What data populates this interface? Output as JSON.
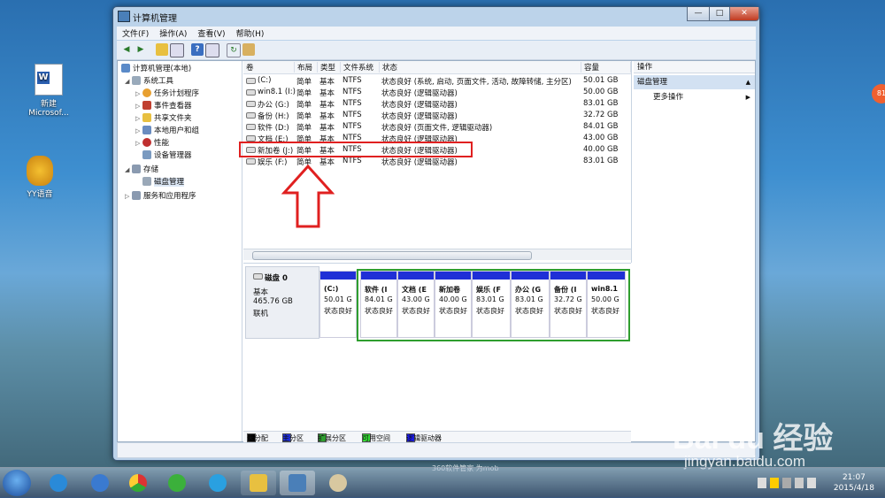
{
  "desktop": {
    "icons": [
      {
        "label": "新建\nMicrosof..."
      },
      {
        "label": "YY语音"
      }
    ],
    "badge": "81"
  },
  "window": {
    "title": "计算机管理",
    "btn_min": "—",
    "btn_max": "□",
    "btn_close": "✕"
  },
  "menu": [
    "文件(F)",
    "操作(A)",
    "查看(V)",
    "帮助(H)"
  ],
  "tree": [
    {
      "label": "计算机管理(本地)",
      "indent": 0,
      "exp": ""
    },
    {
      "label": "系统工具",
      "indent": 1,
      "exp": "◢"
    },
    {
      "label": "任务计划程序",
      "indent": 2,
      "exp": "▷"
    },
    {
      "label": "事件查看器",
      "indent": 2,
      "exp": "▷"
    },
    {
      "label": "共享文件夹",
      "indent": 2,
      "exp": "▷"
    },
    {
      "label": "本地用户和组",
      "indent": 2,
      "exp": "▷"
    },
    {
      "label": "性能",
      "indent": 2,
      "exp": "▷"
    },
    {
      "label": "设备管理器",
      "indent": 2,
      "exp": ""
    },
    {
      "label": "存储",
      "indent": 1,
      "exp": "◢"
    },
    {
      "label": "磁盘管理",
      "indent": 2,
      "exp": ""
    },
    {
      "label": "服务和应用程序",
      "indent": 1,
      "exp": "▷"
    }
  ],
  "list": {
    "headers": [
      "卷",
      "布局",
      "类型",
      "文件系统",
      "状态",
      "容量"
    ],
    "rows": [
      [
        "(C:)",
        "简单",
        "基本",
        "NTFS",
        "状态良好 (系统, 启动, 页面文件, 活动, 故障转储, 主分区)",
        "50.01 GB"
      ],
      [
        "win8.1 (I:)",
        "简单",
        "基本",
        "NTFS",
        "状态良好 (逻辑驱动器)",
        "50.00 GB"
      ],
      [
        "办公 (G:)",
        "简单",
        "基本",
        "NTFS",
        "状态良好 (逻辑驱动器)",
        "83.01 GB"
      ],
      [
        "备份 (H:)",
        "简单",
        "基本",
        "NTFS",
        "状态良好 (逻辑驱动器)",
        "32.72 GB"
      ],
      [
        "软件 (D:)",
        "简单",
        "基本",
        "NTFS",
        "状态良好 (页面文件, 逻辑驱动器)",
        "84.01 GB"
      ],
      [
        "文档 (E:)",
        "简单",
        "基本",
        "NTFS",
        "状态良好 (逻辑驱动器)",
        "43.00 GB"
      ],
      [
        "新加卷 (J:)",
        "简单",
        "基本",
        "NTFS",
        "状态良好 (逻辑驱动器)",
        "40.00 GB"
      ],
      [
        "娱乐 (F:)",
        "简单",
        "基本",
        "NTFS",
        "状态良好 (逻辑驱动器)",
        "83.01 GB"
      ]
    ]
  },
  "disk": {
    "name": "磁盘 0",
    "type": "基本",
    "size": "465.76 GB",
    "state": "联机",
    "parts": [
      {
        "l1": "(C:)",
        "l2": "50.01 G",
        "l3": "状态良好"
      },
      {
        "l1": "软件 (I",
        "l2": "84.01 G",
        "l3": "状态良好"
      },
      {
        "l1": "文档 (E",
        "l2": "43.00 G",
        "l3": "状态良好"
      },
      {
        "l1": "新加卷",
        "l2": "40.00 G",
        "l3": "状态良好"
      },
      {
        "l1": "娱乐 (F",
        "l2": "83.01 G",
        "l3": "状态良好"
      },
      {
        "l1": "办公 (G",
        "l2": "83.01 G",
        "l3": "状态良好"
      },
      {
        "l1": "备份 (I",
        "l2": "32.72 G",
        "l3": "状态良好"
      },
      {
        "l1": "win8.1",
        "l2": "50.00 G",
        "l3": "状态良好"
      }
    ]
  },
  "legend": [
    {
      "label": "未分配",
      "color": "#000000"
    },
    {
      "label": "主分区",
      "color": "#1f2fd6"
    },
    {
      "label": "扩展分区",
      "color": "#2f9e2f"
    },
    {
      "label": "可用空间",
      "color": "#33dd33"
    },
    {
      "label": "逻辑驱动器",
      "color": "#1a1aff"
    }
  ],
  "actions": {
    "header": "操作",
    "section": "磁盘管理",
    "item": "更多操作",
    "section_arrow": "▲",
    "item_arrow": "▶"
  },
  "taskbar": {
    "time": "21:07",
    "date": "2015/4/18",
    "bg_text": "360软件管家 为mob"
  },
  "watermark": {
    "line1": "Bai du 经验",
    "line2": "jingyan.baidu.com"
  }
}
